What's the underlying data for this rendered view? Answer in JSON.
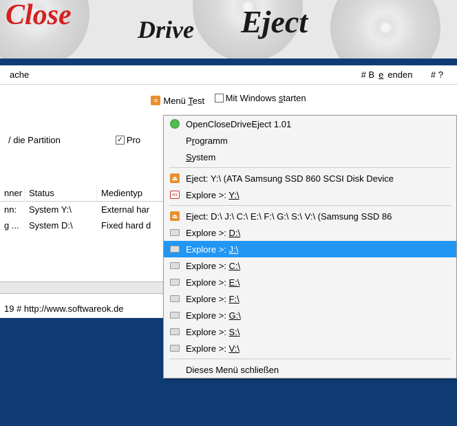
{
  "logo": {
    "close": "Close",
    "drive": "Drive",
    "eject": "Eject"
  },
  "menubar": {
    "left": "ache",
    "right_beenden": "# Beenden",
    "right_q": "# ?"
  },
  "toolbar": {
    "menu_test": "Menü Test",
    "mit_windows": "Mit Windows starten"
  },
  "partition": {
    "label": "/ die Partition",
    "pro": "Pro"
  },
  "table": {
    "headers": [
      "nner",
      "Status",
      "Medientyp"
    ],
    "rows": [
      [
        "nn:",
        "System Y:\\",
        "External har"
      ],
      [
        "g ...",
        "System D:\\",
        "Fixed hard d"
      ]
    ]
  },
  "footer": "19 # http://www.softwareok.de",
  "context_menu": {
    "title": "OpenCloseDriveEject 1.01",
    "programm": "Programm",
    "system": "System",
    "eject_y": "Eject: Y:\\  (ATA Samsung SSD 860 SCSI Disk Device",
    "explore_y": "Explore >: ",
    "explore_y_drive": "Y:\\",
    "eject_multi": "Eject: D:\\ J:\\ C:\\ E:\\ F:\\ G:\\ S:\\ V:\\  (Samsung SSD 86",
    "explore_prefix": "Explore >: ",
    "drives": [
      "D:\\",
      "J:\\",
      "C:\\",
      "E:\\",
      "F:\\",
      "G:\\",
      "S:\\",
      "V:\\"
    ],
    "close": "Dieses Menü schließen"
  }
}
